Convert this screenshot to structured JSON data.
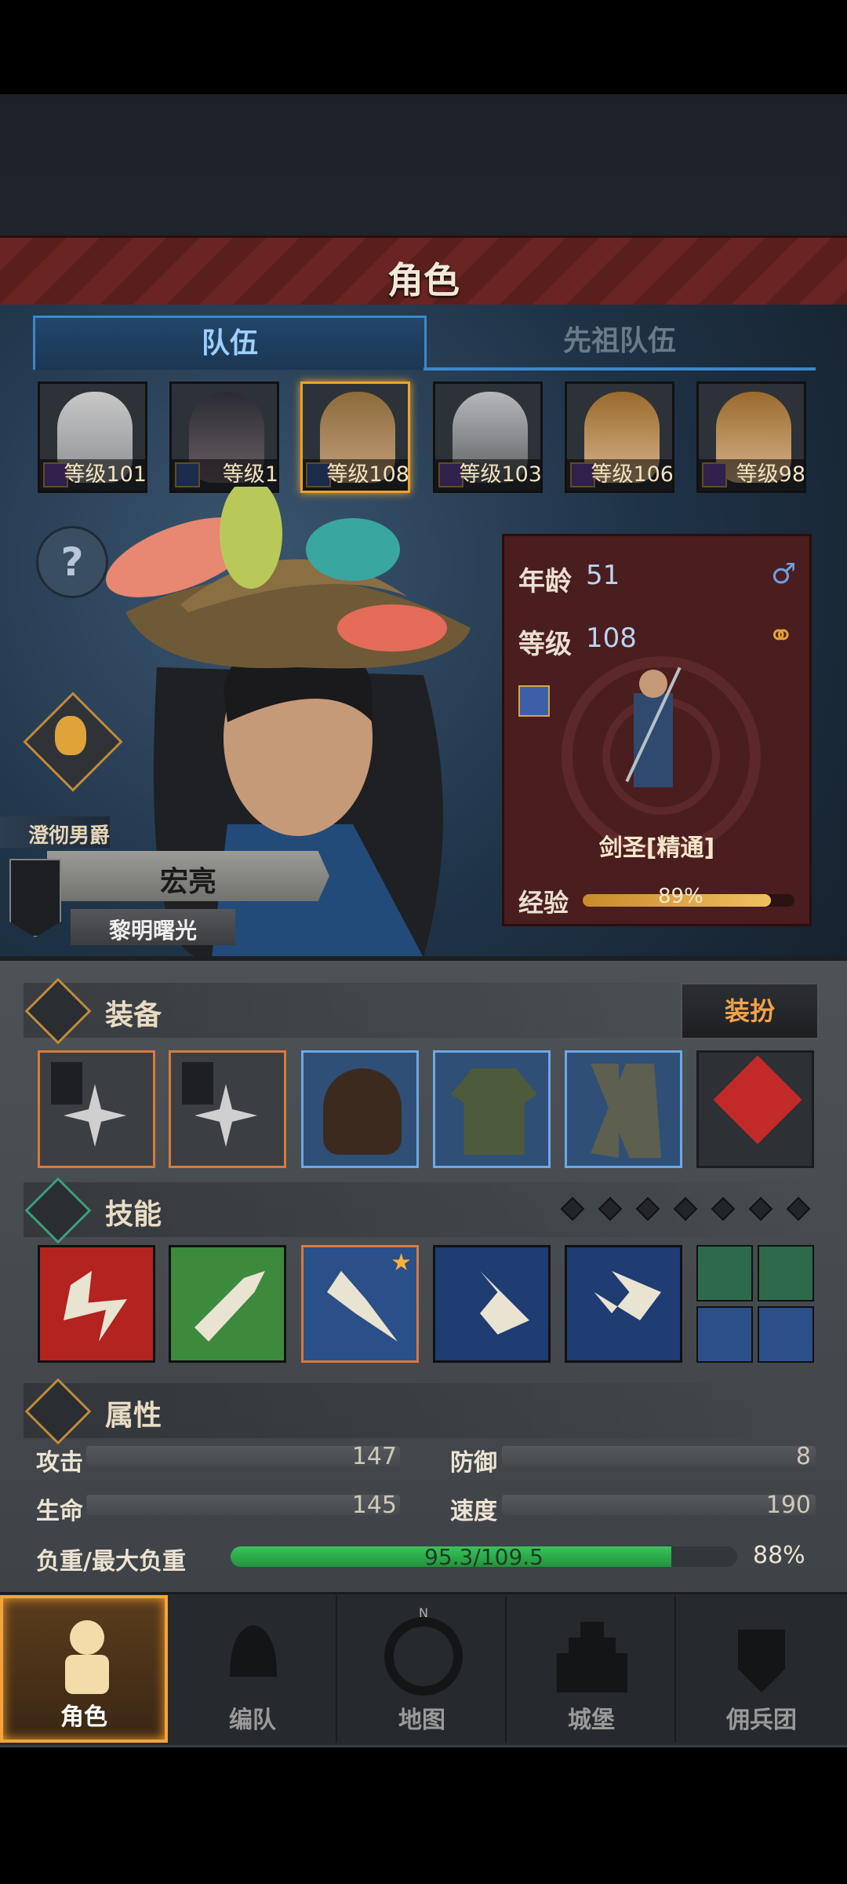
{
  "title": "角色",
  "tabs": [
    {
      "label": "队伍",
      "active": true
    },
    {
      "label": "先祖队伍",
      "active": false
    }
  ],
  "party": [
    {
      "level_label": "等级101",
      "selected": false
    },
    {
      "level_label": "等级1",
      "selected": false
    },
    {
      "level_label": "等级108",
      "selected": true
    },
    {
      "level_label": "等级103",
      "selected": false
    },
    {
      "level_label": "等级106",
      "selected": false
    },
    {
      "level_label": "等级98",
      "selected": false
    }
  ],
  "character": {
    "title_rank": "澄彻男爵",
    "name": "宏亮",
    "epithet": "黎明曙光",
    "age_label": "年龄",
    "age": "51",
    "level_label": "等级",
    "level": "108",
    "class_name": "剑圣[精通]",
    "exp_label": "经验",
    "exp_text": "89%",
    "exp_fraction": 0.89
  },
  "equipment": {
    "label": "装备",
    "dress_button": "装扮"
  },
  "skills": {
    "label": "技能"
  },
  "attributes": {
    "label": "属性",
    "attack_label": "攻击",
    "attack": "147",
    "defense_label": "防御",
    "defense": "8",
    "hp_label": "生命",
    "hp": "145",
    "speed_label": "速度",
    "speed": "190",
    "load_label": "负重/最大负重",
    "load_text": "95.3/109.5",
    "load_percent": "88%",
    "load_fraction": 0.87
  },
  "nav": [
    {
      "label": "角色",
      "active": true
    },
    {
      "label": "编队",
      "active": false
    },
    {
      "label": "地图",
      "active": false
    },
    {
      "label": "城堡",
      "active": false
    },
    {
      "label": "佣兵团",
      "active": false
    }
  ],
  "colors": {
    "accent_orange": "#f0a22a",
    "tab_blue": "#3e86c9",
    "load_green": "#2fa94a",
    "title_red": "#6a2522"
  }
}
